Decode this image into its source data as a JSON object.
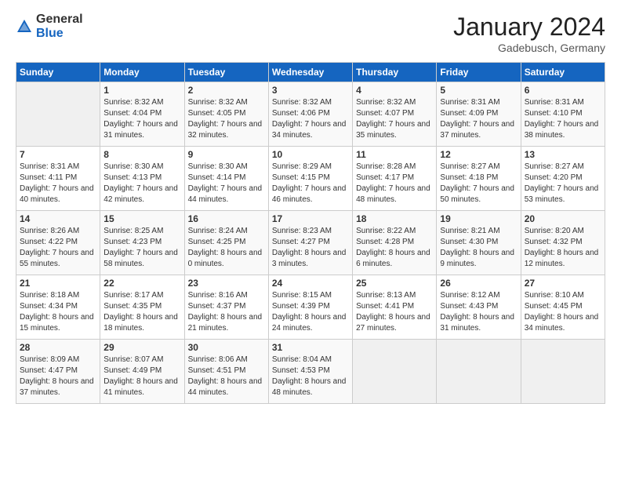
{
  "header": {
    "logo_general": "General",
    "logo_blue": "Blue",
    "month_title": "January 2024",
    "location": "Gadebusch, Germany"
  },
  "days_of_week": [
    "Sunday",
    "Monday",
    "Tuesday",
    "Wednesday",
    "Thursday",
    "Friday",
    "Saturday"
  ],
  "weeks": [
    [
      {
        "num": "",
        "sunrise": "",
        "sunset": "",
        "daylight": ""
      },
      {
        "num": "1",
        "sunrise": "Sunrise: 8:32 AM",
        "sunset": "Sunset: 4:04 PM",
        "daylight": "Daylight: 7 hours and 31 minutes."
      },
      {
        "num": "2",
        "sunrise": "Sunrise: 8:32 AM",
        "sunset": "Sunset: 4:05 PM",
        "daylight": "Daylight: 7 hours and 32 minutes."
      },
      {
        "num": "3",
        "sunrise": "Sunrise: 8:32 AM",
        "sunset": "Sunset: 4:06 PM",
        "daylight": "Daylight: 7 hours and 34 minutes."
      },
      {
        "num": "4",
        "sunrise": "Sunrise: 8:32 AM",
        "sunset": "Sunset: 4:07 PM",
        "daylight": "Daylight: 7 hours and 35 minutes."
      },
      {
        "num": "5",
        "sunrise": "Sunrise: 8:31 AM",
        "sunset": "Sunset: 4:09 PM",
        "daylight": "Daylight: 7 hours and 37 minutes."
      },
      {
        "num": "6",
        "sunrise": "Sunrise: 8:31 AM",
        "sunset": "Sunset: 4:10 PM",
        "daylight": "Daylight: 7 hours and 38 minutes."
      }
    ],
    [
      {
        "num": "7",
        "sunrise": "Sunrise: 8:31 AM",
        "sunset": "Sunset: 4:11 PM",
        "daylight": "Daylight: 7 hours and 40 minutes."
      },
      {
        "num": "8",
        "sunrise": "Sunrise: 8:30 AM",
        "sunset": "Sunset: 4:13 PM",
        "daylight": "Daylight: 7 hours and 42 minutes."
      },
      {
        "num": "9",
        "sunrise": "Sunrise: 8:30 AM",
        "sunset": "Sunset: 4:14 PM",
        "daylight": "Daylight: 7 hours and 44 minutes."
      },
      {
        "num": "10",
        "sunrise": "Sunrise: 8:29 AM",
        "sunset": "Sunset: 4:15 PM",
        "daylight": "Daylight: 7 hours and 46 minutes."
      },
      {
        "num": "11",
        "sunrise": "Sunrise: 8:28 AM",
        "sunset": "Sunset: 4:17 PM",
        "daylight": "Daylight: 7 hours and 48 minutes."
      },
      {
        "num": "12",
        "sunrise": "Sunrise: 8:27 AM",
        "sunset": "Sunset: 4:18 PM",
        "daylight": "Daylight: 7 hours and 50 minutes."
      },
      {
        "num": "13",
        "sunrise": "Sunrise: 8:27 AM",
        "sunset": "Sunset: 4:20 PM",
        "daylight": "Daylight: 7 hours and 53 minutes."
      }
    ],
    [
      {
        "num": "14",
        "sunrise": "Sunrise: 8:26 AM",
        "sunset": "Sunset: 4:22 PM",
        "daylight": "Daylight: 7 hours and 55 minutes."
      },
      {
        "num": "15",
        "sunrise": "Sunrise: 8:25 AM",
        "sunset": "Sunset: 4:23 PM",
        "daylight": "Daylight: 7 hours and 58 minutes."
      },
      {
        "num": "16",
        "sunrise": "Sunrise: 8:24 AM",
        "sunset": "Sunset: 4:25 PM",
        "daylight": "Daylight: 8 hours and 0 minutes."
      },
      {
        "num": "17",
        "sunrise": "Sunrise: 8:23 AM",
        "sunset": "Sunset: 4:27 PM",
        "daylight": "Daylight: 8 hours and 3 minutes."
      },
      {
        "num": "18",
        "sunrise": "Sunrise: 8:22 AM",
        "sunset": "Sunset: 4:28 PM",
        "daylight": "Daylight: 8 hours and 6 minutes."
      },
      {
        "num": "19",
        "sunrise": "Sunrise: 8:21 AM",
        "sunset": "Sunset: 4:30 PM",
        "daylight": "Daylight: 8 hours and 9 minutes."
      },
      {
        "num": "20",
        "sunrise": "Sunrise: 8:20 AM",
        "sunset": "Sunset: 4:32 PM",
        "daylight": "Daylight: 8 hours and 12 minutes."
      }
    ],
    [
      {
        "num": "21",
        "sunrise": "Sunrise: 8:18 AM",
        "sunset": "Sunset: 4:34 PM",
        "daylight": "Daylight: 8 hours and 15 minutes."
      },
      {
        "num": "22",
        "sunrise": "Sunrise: 8:17 AM",
        "sunset": "Sunset: 4:35 PM",
        "daylight": "Daylight: 8 hours and 18 minutes."
      },
      {
        "num": "23",
        "sunrise": "Sunrise: 8:16 AM",
        "sunset": "Sunset: 4:37 PM",
        "daylight": "Daylight: 8 hours and 21 minutes."
      },
      {
        "num": "24",
        "sunrise": "Sunrise: 8:15 AM",
        "sunset": "Sunset: 4:39 PM",
        "daylight": "Daylight: 8 hours and 24 minutes."
      },
      {
        "num": "25",
        "sunrise": "Sunrise: 8:13 AM",
        "sunset": "Sunset: 4:41 PM",
        "daylight": "Daylight: 8 hours and 27 minutes."
      },
      {
        "num": "26",
        "sunrise": "Sunrise: 8:12 AM",
        "sunset": "Sunset: 4:43 PM",
        "daylight": "Daylight: 8 hours and 31 minutes."
      },
      {
        "num": "27",
        "sunrise": "Sunrise: 8:10 AM",
        "sunset": "Sunset: 4:45 PM",
        "daylight": "Daylight: 8 hours and 34 minutes."
      }
    ],
    [
      {
        "num": "28",
        "sunrise": "Sunrise: 8:09 AM",
        "sunset": "Sunset: 4:47 PM",
        "daylight": "Daylight: 8 hours and 37 minutes."
      },
      {
        "num": "29",
        "sunrise": "Sunrise: 8:07 AM",
        "sunset": "Sunset: 4:49 PM",
        "daylight": "Daylight: 8 hours and 41 minutes."
      },
      {
        "num": "30",
        "sunrise": "Sunrise: 8:06 AM",
        "sunset": "Sunset: 4:51 PM",
        "daylight": "Daylight: 8 hours and 44 minutes."
      },
      {
        "num": "31",
        "sunrise": "Sunrise: 8:04 AM",
        "sunset": "Sunset: 4:53 PM",
        "daylight": "Daylight: 8 hours and 48 minutes."
      },
      {
        "num": "",
        "sunrise": "",
        "sunset": "",
        "daylight": ""
      },
      {
        "num": "",
        "sunrise": "",
        "sunset": "",
        "daylight": ""
      },
      {
        "num": "",
        "sunrise": "",
        "sunset": "",
        "daylight": ""
      }
    ]
  ]
}
